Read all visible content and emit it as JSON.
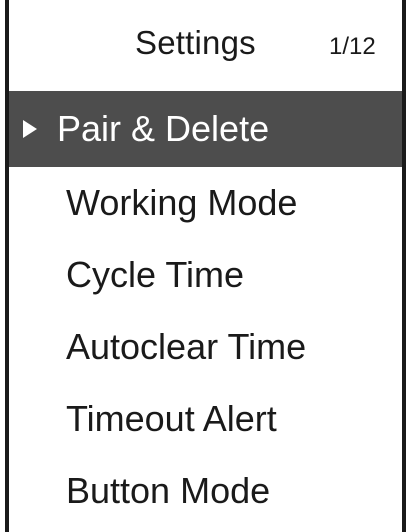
{
  "header": {
    "title": "Settings",
    "page_indicator": "1/12"
  },
  "menu": {
    "selected_index": 0,
    "items": [
      {
        "label": "Pair & Delete",
        "selected": true
      },
      {
        "label": "Working Mode",
        "selected": false
      },
      {
        "label": "Cycle Time",
        "selected": false
      },
      {
        "label": "Autoclear Time",
        "selected": false
      },
      {
        "label": "Timeout Alert",
        "selected": false
      },
      {
        "label": "Button Mode",
        "selected": false
      }
    ]
  },
  "icons": {
    "cursor": "triangle-right-icon"
  },
  "colors": {
    "background": "#ffffff",
    "text": "#1a1a1a",
    "selection_background": "#4d4d4d",
    "selection_text": "#ffffff"
  }
}
